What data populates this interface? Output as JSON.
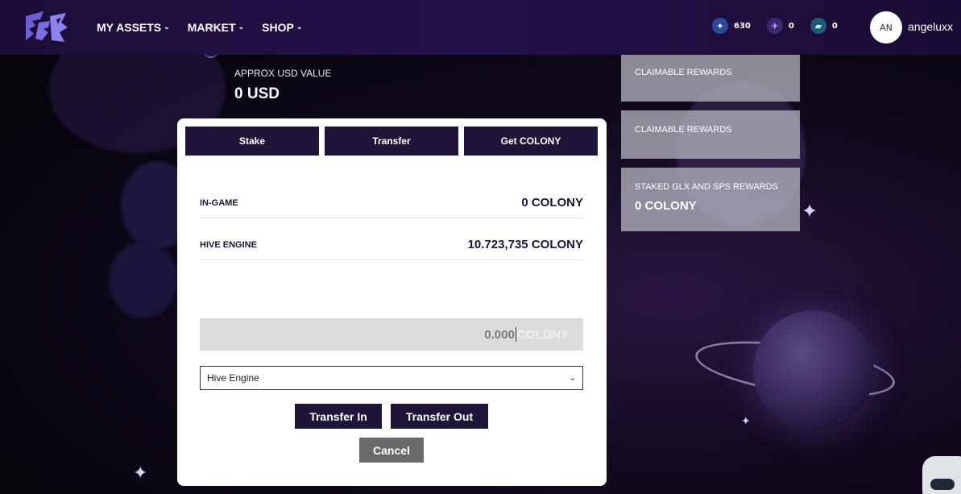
{
  "header": {
    "nav": [
      {
        "label": "MY ASSETS"
      },
      {
        "label": "MARKET"
      },
      {
        "label": "SHOP"
      }
    ],
    "stats": [
      {
        "icon": "star-token-icon",
        "value": "630"
      },
      {
        "icon": "spaceship-icon",
        "value": "0"
      },
      {
        "icon": "ticket-icon",
        "value": "0"
      }
    ],
    "avatar_initials": "AN",
    "username": "angeluxx"
  },
  "background": {
    "usd_label": "APPROX USD VALUE",
    "usd_value": "0 USD",
    "reward_cards": [
      {
        "title": "CLAIMABLE REWARDS",
        "value": ""
      },
      {
        "title": "CLAIMABLE REWARDS",
        "value": ""
      },
      {
        "title": "STAKED GLX AND SPS REWARDS",
        "value": "0 COLONY"
      }
    ]
  },
  "modal": {
    "tabs": [
      {
        "label": "Stake"
      },
      {
        "label": "Transfer"
      },
      {
        "label": "Get COLONY"
      }
    ],
    "balances": [
      {
        "label": "IN-GAME",
        "value": "0 COLONY"
      },
      {
        "label": "HIVE ENGINE",
        "value": "10.723,735 COLONY"
      }
    ],
    "amount_input": {
      "value": "0.000",
      "unit": "COLONY"
    },
    "source_select": {
      "selected": "Hive Engine"
    },
    "transfer_in_label": "Transfer In",
    "transfer_out_label": "Transfer Out",
    "cancel_label": "Cancel"
  },
  "colors": {
    "header_bg": "#24114a",
    "button_bg": "#1e1538",
    "cancel_bg": "#6a6a6a",
    "reward_card_bg": "#bebec8"
  }
}
